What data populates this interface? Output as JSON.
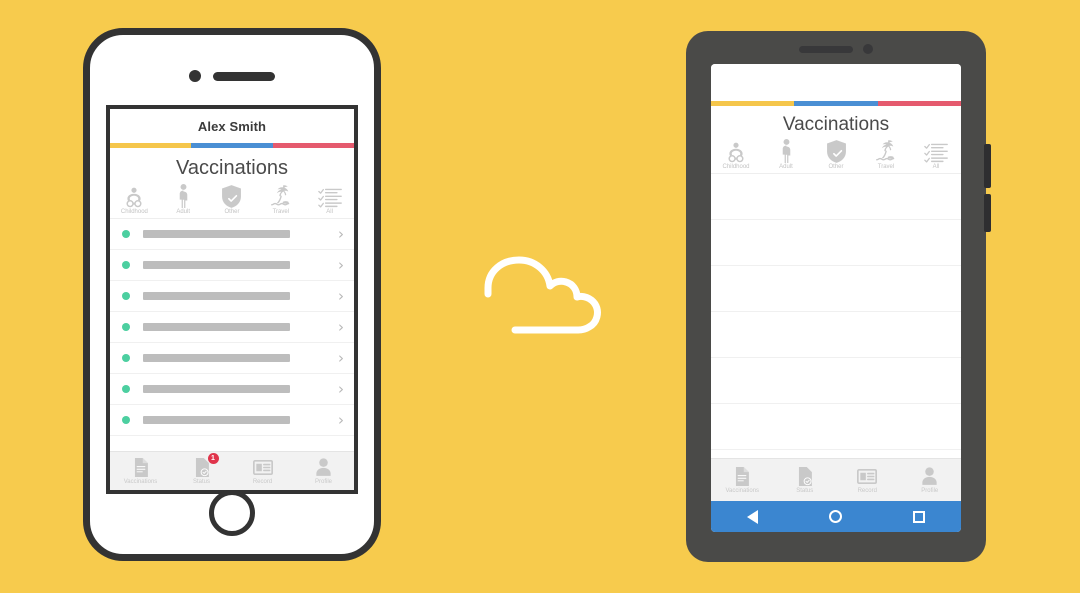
{
  "scene": {
    "background_color": "#f7cb4d",
    "description": "Vaccination app shown syncing between a phone and a tablet via a cloud"
  },
  "cloud": {
    "icon": "cloud-icon",
    "color": "#ffffff"
  },
  "brand": {
    "stripe_colors": [
      "#f5c64b",
      "#4a8fd4",
      "#e55a6e"
    ],
    "status_dot_color": "#4ccfa0",
    "badge_color": "#e0344b",
    "android_navbar_color": "#3b86d0"
  },
  "phone": {
    "device": "phone",
    "user_name": "Alex Smith",
    "screen_title": "Vaccinations",
    "categories": [
      {
        "label": "Childhood",
        "icon": "baby-icon"
      },
      {
        "label": "Adult",
        "icon": "adult-person-icon"
      },
      {
        "label": "Other",
        "icon": "shield-check-icon"
      },
      {
        "label": "Travel",
        "icon": "palm-tree-island-icon"
      },
      {
        "label": "All",
        "icon": "checklist-icon"
      }
    ],
    "list_rows": [
      {
        "status": "ok",
        "loaded": true
      },
      {
        "status": "ok",
        "loaded": true
      },
      {
        "status": "ok",
        "loaded": true
      },
      {
        "status": "ok",
        "loaded": true
      },
      {
        "status": "ok",
        "loaded": true
      },
      {
        "status": "ok",
        "loaded": true
      },
      {
        "status": "ok",
        "loaded": true
      }
    ],
    "tabs": [
      {
        "label": "Vaccinations",
        "icon": "document-icon",
        "badge": ""
      },
      {
        "label": "Status",
        "icon": "clipboard-check-icon",
        "badge": "1"
      },
      {
        "label": "Record",
        "icon": "id-card-icon",
        "badge": ""
      },
      {
        "label": "Profile",
        "icon": "person-icon",
        "badge": ""
      }
    ],
    "hardware": {
      "camera": "front-camera",
      "speaker": "earpiece-speaker",
      "home_button": "home-button"
    }
  },
  "tablet": {
    "device": "tablet",
    "screen_title": "Vaccinations",
    "categories": [
      {
        "label": "Childhood",
        "icon": "baby-icon"
      },
      {
        "label": "Adult",
        "icon": "adult-person-icon"
      },
      {
        "label": "Other",
        "icon": "shield-check-icon"
      },
      {
        "label": "Travel",
        "icon": "palm-tree-island-icon"
      },
      {
        "label": "All",
        "icon": "checklist-icon"
      }
    ],
    "list_rows": [
      {
        "status": "empty",
        "loaded": false
      },
      {
        "status": "empty",
        "loaded": false
      },
      {
        "status": "empty",
        "loaded": false
      },
      {
        "status": "empty",
        "loaded": false
      },
      {
        "status": "empty",
        "loaded": false
      },
      {
        "status": "empty",
        "loaded": false
      },
      {
        "status": "empty",
        "loaded": false,
        "chevron": true
      }
    ],
    "tabs": [
      {
        "label": "Vaccinations",
        "icon": "document-icon",
        "badge": ""
      },
      {
        "label": "Status",
        "icon": "clipboard-check-icon",
        "badge": ""
      },
      {
        "label": "Record",
        "icon": "id-card-icon",
        "badge": ""
      },
      {
        "label": "Profile",
        "icon": "person-icon",
        "badge": ""
      }
    ],
    "navbar": [
      {
        "name": "back",
        "icon": "triangle-back-icon"
      },
      {
        "name": "home",
        "icon": "circle-home-icon"
      },
      {
        "name": "recents",
        "icon": "square-recents-icon"
      }
    ],
    "hardware": {
      "camera": "front-camera",
      "speaker": "earpiece-speaker",
      "side_buttons": [
        "volume-button",
        "power-button"
      ]
    }
  }
}
